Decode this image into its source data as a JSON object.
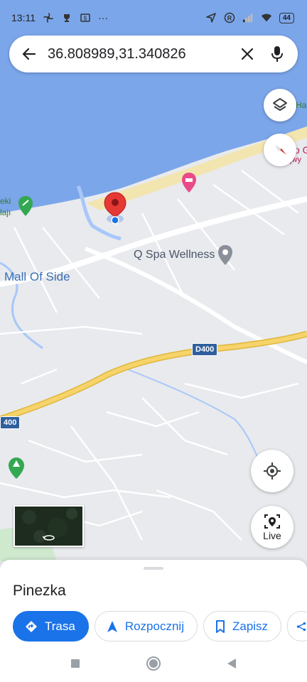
{
  "status": {
    "time": "13:11",
    "battery": "44",
    "more": "···"
  },
  "search": {
    "query": "36.808989,31.340826"
  },
  "map": {
    "labels": {
      "spa": "Q Spa Wellness",
      "mall": "Mall Of Side",
      "road": "D400",
      "road_left": "400",
      "edge_top_right": "Ha",
      "edge_hotel": "o G",
      "edge_hotel_sub": "ajwy",
      "edge_left_top": "eki",
      "edge_left_sub": "lajı"
    },
    "colors": {
      "sea": "#7ba6ea",
      "land": "#e8eaed",
      "beach": "#f5e7b5",
      "highway": "#f0c94d",
      "pin": "#e53935",
      "accent": "#1a73e8"
    }
  },
  "controls": {
    "live_label": "Live"
  },
  "sheet": {
    "title": "Pinezka",
    "actions": {
      "directions": "Trasa",
      "start": "Rozpocznij",
      "save": "Zapisz"
    }
  }
}
